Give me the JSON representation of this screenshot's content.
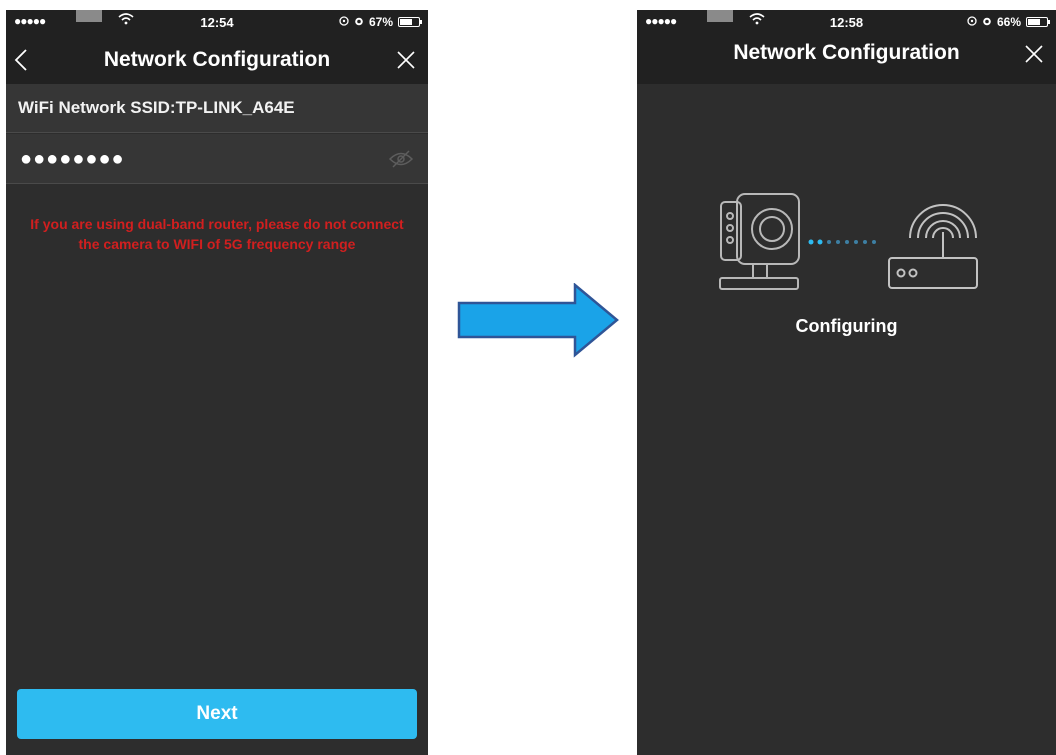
{
  "left_screen": {
    "status": {
      "signal": "●●●●●",
      "time": "12:54",
      "battery": "67%",
      "battery_level": 0.67
    },
    "nav": {
      "title": "Network Configuration"
    },
    "ssid": {
      "text": "WiFi Network SSID:TP-LINK_A64E"
    },
    "password": {
      "value": "●●●●●●●●"
    },
    "warning": "If you are using dual-band router, please do not connect the camera to WIFI of 5G frequency range",
    "next_label": "Next"
  },
  "right_screen": {
    "status": {
      "signal": "●●●●●",
      "time": "12:58",
      "battery": "66%",
      "battery_level": 0.66
    },
    "nav": {
      "title": "Network Configuration"
    },
    "status_text": "Configuring"
  },
  "icons": {
    "back": "chevron-left-icon",
    "close": "close-icon",
    "password_toggle": "eye-slash-icon",
    "camera": "camera-icon",
    "router": "router-icon",
    "transition": "arrow-right-icon"
  },
  "colors": {
    "screen_bg": "#2d2d2d",
    "bar_bg": "#212121",
    "accent": "#2ebbf0",
    "warning": "#d11f1f",
    "arrow_fill": "#1aa3e8",
    "arrow_stroke": "#2f5597"
  }
}
